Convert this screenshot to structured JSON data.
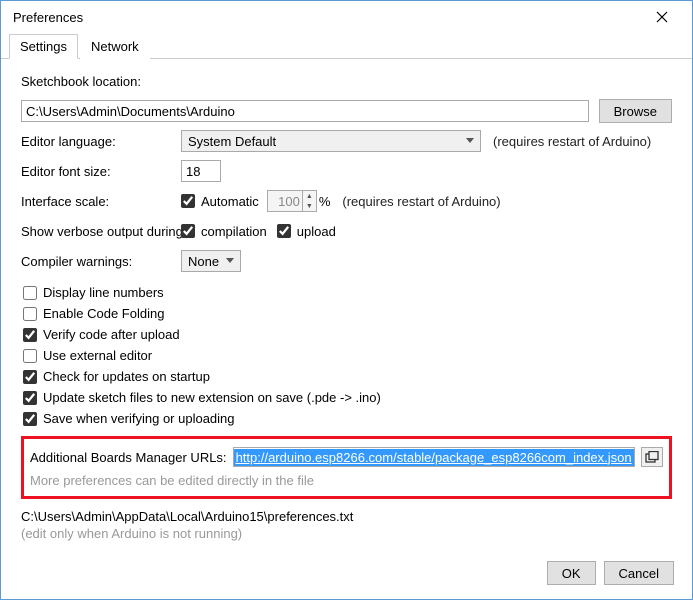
{
  "window": {
    "title": "Preferences"
  },
  "tabs": {
    "settings": "Settings",
    "network": "Network"
  },
  "sketchbook": {
    "label": "Sketchbook location:",
    "path": "C:\\Users\\Admin\\Documents\\Arduino",
    "browse": "Browse"
  },
  "editor_language": {
    "label": "Editor language:",
    "value": "System Default",
    "hint": "(requires restart of Arduino)"
  },
  "editor_font": {
    "label": "Editor font size:",
    "value": "18"
  },
  "interface_scale": {
    "label": "Interface scale:",
    "automatic_label": "Automatic",
    "automatic": true,
    "percent": "100",
    "percent_suffix": "%",
    "hint": "(requires restart of Arduino)"
  },
  "verbose": {
    "label": "Show verbose output during:",
    "compilation_label": "compilation",
    "compilation": true,
    "upload_label": "upload",
    "upload": true
  },
  "compiler_warnings": {
    "label": "Compiler warnings:",
    "value": "None"
  },
  "checkboxes": {
    "display_line_numbers": {
      "label": "Display line numbers",
      "checked": false
    },
    "enable_code_folding": {
      "label": "Enable Code Folding",
      "checked": false
    },
    "verify_after_upload": {
      "label": "Verify code after upload",
      "checked": true
    },
    "use_external_editor": {
      "label": "Use external editor",
      "checked": false
    },
    "check_updates": {
      "label": "Check for updates on startup",
      "checked": true
    },
    "update_sketch_ext": {
      "label": "Update sketch files to new extension on save (.pde -> .ino)",
      "checked": true
    },
    "save_on_verify_upload": {
      "label": "Save when verifying or uploading",
      "checked": true
    }
  },
  "boards_url": {
    "label": "Additional Boards Manager URLs:",
    "value": "http://arduino.esp8266.com/stable/package_esp8266com_index.json"
  },
  "more_prefs": {
    "note": "More preferences can be edited directly in the file",
    "path": "C:\\Users\\Admin\\AppData\\Local\\Arduino15\\preferences.txt",
    "edit_note": "(edit only when Arduino is not running)"
  },
  "buttons": {
    "ok": "OK",
    "cancel": "Cancel"
  }
}
